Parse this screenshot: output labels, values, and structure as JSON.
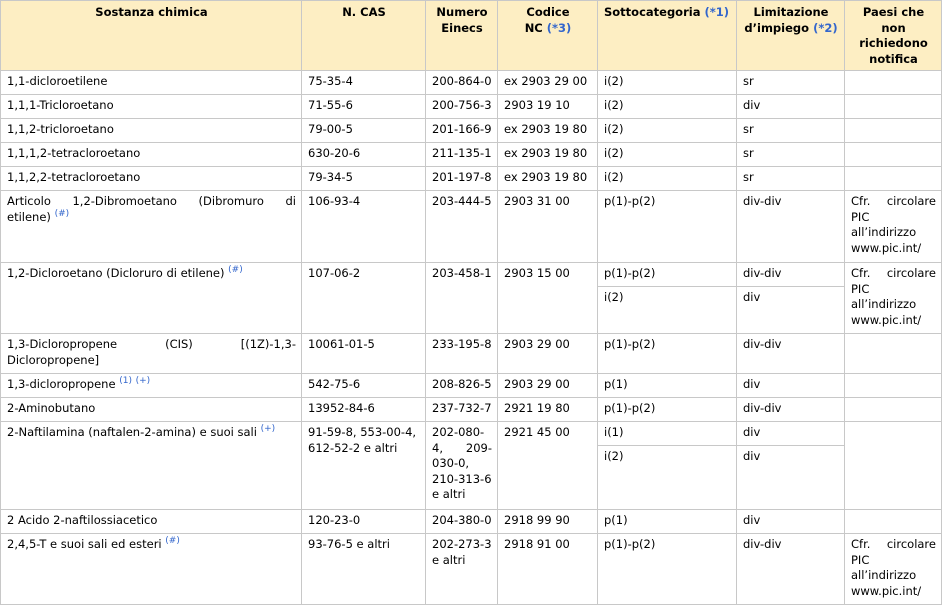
{
  "headers": {
    "substance": "Sostanza chimica",
    "cas": "N. CAS",
    "einecs_1": "Numero",
    "einecs_2": "Einecs",
    "nc_1": "Codice",
    "nc_2": "NC",
    "nc_ref": "(*3)",
    "subcat": "Sottocategoria",
    "subcat_ref": "(*1)",
    "limit_1": "Limitazione",
    "limit_2": "d’impiego",
    "limit_ref": "(*2)",
    "countries": "Paesi che non richiedono notifica"
  },
  "rows": [
    {
      "substance": "1,1-dicloroetilene",
      "cas": "75-35-4",
      "einecs": "200-864-0",
      "nc": "ex 2903 29 00",
      "subcat": "i(2)",
      "limit": "sr",
      "countries": ""
    },
    {
      "substance": "1,1,1-Tricloroetano",
      "cas": "71-55-6",
      "einecs": "200-756-3",
      "nc": "2903 19 10",
      "subcat": "i(2)",
      "limit": "div",
      "countries": ""
    },
    {
      "substance": "1,1,2-tricloroetano",
      "cas": "79-00-5",
      "einecs": "201-166-9",
      "nc": "ex 2903 19 80",
      "subcat": "i(2)",
      "limit": "sr",
      "countries": ""
    },
    {
      "substance": "1,1,1,2-tetracloroetano",
      "cas": "630-20-6",
      "einecs": "211-135-1",
      "nc": "ex 2903 19 80",
      "subcat": "i(2)",
      "limit": "sr",
      "countries": ""
    },
    {
      "substance": "1,1,2,2-tetracloroetano",
      "cas": "79-34-5",
      "einecs": "201-197-8",
      "nc": "ex 2903 19 80",
      "subcat": "i(2)",
      "limit": "sr",
      "countries": ""
    },
    {
      "substance_a": "Articolo 1,2-Dibromoetano (Dibromuro di",
      "substance_b": "etilene)",
      "ref": "(#)",
      "cas": "106-93-4",
      "einecs": "203-444-5",
      "nc": "2903 31 00",
      "subcat": "p(1)-p(2)",
      "limit": "div-div",
      "countries_a": "Cfr. circolare",
      "countries_b": "PIC all’indirizzo www.pic.int/"
    },
    {
      "substance": "1,2-Dicloroetano (Dicloruro di etilene)",
      "ref": "(#)",
      "cas": "107-06-2",
      "einecs": "203-458-1",
      "nc": "2903 15 00",
      "subcat_1": "p(1)-p(2)",
      "limit_1": "div-div",
      "subcat_2": "i(2)",
      "limit_2": "div",
      "countries_a": "Cfr. circolare",
      "countries_b": "PIC all’indirizzo www.pic.int/"
    },
    {
      "substance_a": "1,3-Dicloropropene (CIS) [(1Z)-1,3-",
      "substance_b": "Dicloropropene]",
      "cas": "10061-01-5",
      "einecs": "233-195-8",
      "nc": "2903 29 00",
      "subcat": "p(1)-p(2)",
      "limit": "div-div",
      "countries": ""
    },
    {
      "substance": "1,3-dicloropropene",
      "ref1": "(1)",
      "ref2": "(+)",
      "cas": "542-75-6",
      "einecs": "208-826-5",
      "nc": "2903 29 00",
      "subcat": "p(1)",
      "limit": "div",
      "countries": ""
    },
    {
      "substance": "2-Aminobutano",
      "cas": "13952-84-6",
      "einecs": "237-732-7",
      "nc": "2921 19 80",
      "subcat": "p(1)-p(2)",
      "limit": "div-div",
      "countries": ""
    },
    {
      "substance": "2-Naftilamina (naftalen-2-amina) e suoi sali",
      "ref": "(+)",
      "cas": "91-59-8, 553-00-4, 612-52-2 e altri",
      "einecs_a": "202-080-4, 209-",
      "einecs_b": "030-0, 210-313-6 e altri",
      "nc": "2921 45 00",
      "subcat_1": "i(1)",
      "limit_1": "div",
      "subcat_2": "i(2)",
      "limit_2": "div",
      "countries": ""
    },
    {
      "substance": "2 Acido 2-naftilossiacetico",
      "cas": "120-23-0",
      "einecs": "204-380-0",
      "nc": "2918 99 90",
      "subcat": "p(1)",
      "limit": "div",
      "countries": ""
    },
    {
      "substance": "2,4,5-T e suoi sali ed esteri",
      "ref": "(#)",
      "cas": "93-76-5 e altri",
      "einecs_a": "202-273-3",
      "einecs_b": "e altri",
      "nc": "2918 91 00",
      "subcat": "p(1)-p(2)",
      "limit": "div-div",
      "countries_a": "Cfr. circolare",
      "countries_b": "PIC all’indirizzo www.pic.int/"
    }
  ]
}
